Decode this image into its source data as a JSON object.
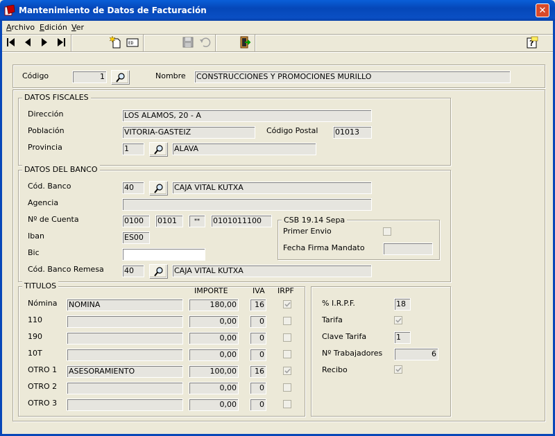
{
  "window": {
    "title": "Mantenimiento de Datos de Facturación"
  },
  "menu": {
    "archivo": "Archivo",
    "edicion": "Edición",
    "ver": "Ver"
  },
  "header": {
    "codigo_label": "Código",
    "codigo_value": "1",
    "nombre_label": "Nombre",
    "nombre_value": "CONSTRUCCIONES Y PROMOCIONES MURILLO"
  },
  "fiscales": {
    "title": "DATOS FISCALES",
    "direccion_label": "Dirección",
    "direccion_value": "LOS ALAMOS, 20 - A",
    "poblacion_label": "Población",
    "poblacion_value": "VITORIA-GASTEIZ",
    "cp_label": "Código Postal",
    "cp_value": "01013",
    "provincia_label": "Provincia",
    "provincia_code": "1",
    "provincia_name": "ALAVA"
  },
  "banco": {
    "title": "DATOS DEL BANCO",
    "cod_label": "Cód. Banco",
    "cod_value": "40",
    "cod_name": "CAJA VITAL KUTXA",
    "agencia_label": "Agencia",
    "agencia_value": "",
    "cuenta_label": "Nº de Cuenta",
    "cuenta_1": "0100",
    "cuenta_2": "0101",
    "cuenta_3": "**",
    "cuenta_4": "0101011100",
    "iban_label": "Iban",
    "iban_value": "ES00",
    "bic_label": "Bic",
    "bic_value": "",
    "remesa_label": "Cód. Banco Remesa",
    "remesa_value": "40",
    "remesa_name": "CAJA VITAL KUTXA",
    "csb": {
      "title": "CSB 19.14 Sepa",
      "primer_envio_label": "Primer Envio",
      "primer_envio_checked": false,
      "fecha_label": "Fecha Firma Mandato",
      "fecha_value": ""
    }
  },
  "titulos": {
    "title": "TITULOS",
    "col_importe": "IMPORTE",
    "col_iva": "IVA",
    "col_irpf": "IRPF",
    "rows": [
      {
        "label": "Nómina",
        "desc": "NOMINA",
        "importe": "180,00",
        "iva": "16",
        "irpf": true
      },
      {
        "label": "110",
        "desc": "",
        "importe": "0,00",
        "iva": "0",
        "irpf": false
      },
      {
        "label": "190",
        "desc": "",
        "importe": "0,00",
        "iva": "0",
        "irpf": false
      },
      {
        "label": "10T",
        "desc": "",
        "importe": "0,00",
        "iva": "0",
        "irpf": false
      },
      {
        "label": "OTRO 1",
        "desc": "ASESORAMIENTO",
        "importe": "100,00",
        "iva": "16",
        "irpf": true
      },
      {
        "label": "OTRO 2",
        "desc": "",
        "importe": "0,00",
        "iva": "0",
        "irpf": false
      },
      {
        "label": "OTRO 3",
        "desc": "",
        "importe": "0,00",
        "iva": "0",
        "irpf": false
      }
    ]
  },
  "right": {
    "irpf_label": "% I.R.P.F.",
    "irpf_value": "18",
    "tarifa_label": "Tarifa",
    "tarifa_checked": true,
    "clave_label": "Clave Tarifa",
    "clave_value": "1",
    "trabajadores_label": "Nº Trabajadores",
    "trabajadores_value": "6",
    "recibo_label": "Recibo",
    "recibo_checked": true
  },
  "toolbar": {
    "icons": [
      "first-record-icon",
      "previous-record-icon",
      "next-record-icon",
      "last-record-icon",
      "new-record-icon",
      "edit-record-icon",
      "save-icon",
      "undo-icon",
      "exit-icon",
      "help-icon"
    ]
  }
}
